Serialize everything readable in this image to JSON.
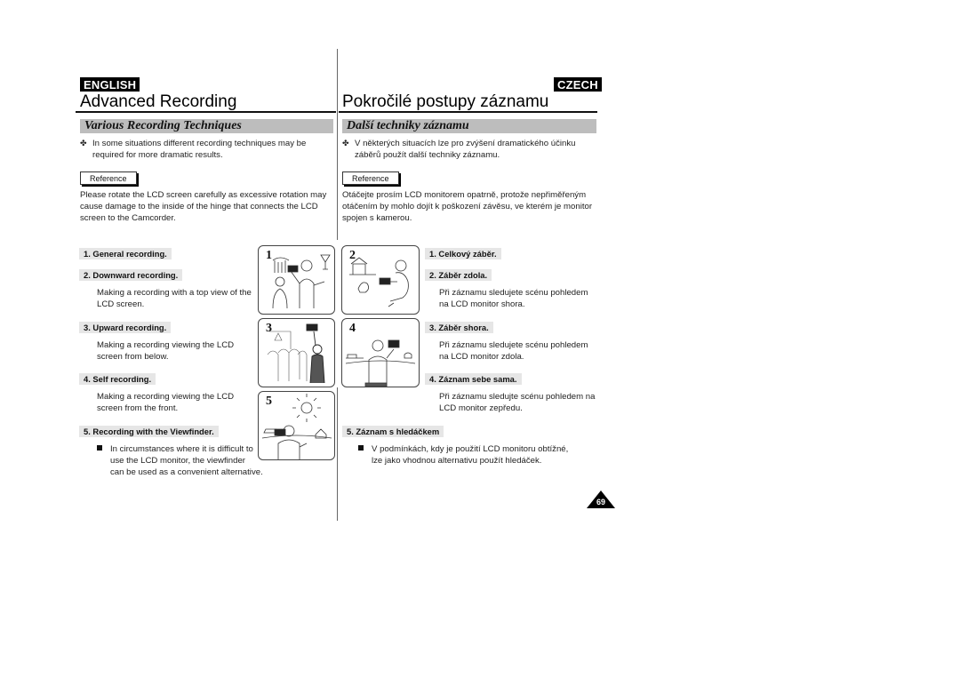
{
  "left": {
    "language_tag": "ENGLISH",
    "title": "Advanced Recording",
    "section_title": "Various Recording Techniques",
    "intro_bullet": "✤",
    "intro_lines": [
      "In some situations different recording techniques may be",
      "required for more dramatic results."
    ],
    "reference_label": "Reference",
    "reference_lines": [
      "Please rotate the LCD screen carefully as excessive rotation may",
      "cause damage to the inside of the hinge that connects the LCD",
      "screen to the Camcorder."
    ],
    "items": [
      {
        "head": "1.  General recording.",
        "body": []
      },
      {
        "head": "2.  Downward recording.",
        "body": [
          "Making a recording with a top view of the",
          "LCD screen."
        ]
      },
      {
        "head": "3.  Upward recording.",
        "body": [
          "Making a recording viewing the LCD",
          "screen from below."
        ]
      },
      {
        "head": "4.  Self recording.",
        "body": [
          "Making a recording viewing the LCD",
          "screen from the front."
        ]
      },
      {
        "head": "5.  Recording with the Viewfinder.",
        "body": [
          "In circumstances where it is difficult to",
          "use the LCD monitor, the viewfinder",
          "can be used as a convenient alternative."
        ]
      }
    ]
  },
  "right": {
    "language_tag": "CZECH",
    "title": "Pokročilé postupy záznamu",
    "section_title": "Další techniky záznamu",
    "intro_bullet": "✤",
    "intro_lines": [
      "V některých situacích lze pro zvýšení dramatického účinku",
      "záběrů použít další techniky záznamu."
    ],
    "reference_label": "Reference",
    "reference_lines": [
      "Otáčejte prosím LCD monitorem opatrně, protože nepřiměřeným",
      "otáčením by mohlo dojít k poškození závěsu, ve kterém je monitor",
      "spojen s kamerou."
    ],
    "items": [
      {
        "head": "1. Celkový záběr.",
        "body": []
      },
      {
        "head": "2. Záběr zdola.",
        "body": [
          "Při záznamu sledujete scénu pohledem",
          "na LCD monitor shora."
        ]
      },
      {
        "head": "3. Záběr shora.",
        "body": [
          "Při záznamu sledujete scénu pohledem",
          "na LCD monitor zdola."
        ]
      },
      {
        "head": "4. Záznam sebe sama.",
        "body": [
          "Při záznamu sledujte scénu pohledem na",
          "LCD monitor zepředu."
        ]
      },
      {
        "head": "5. Záznam s hledáčkem",
        "body": [
          "V podmínkách, kdy je použití LCD monitoru obtížné,",
          "lze jako vhodnou alternativu použít hledáček."
        ]
      }
    ]
  },
  "panels": [
    {
      "number": "1",
      "scene": "camcorder held at chest height filming a person, wine glasses in background"
    },
    {
      "number": "2",
      "scene": "crouching person filming a dog near a doghouse"
    },
    {
      "number": "3",
      "scene": "camcorder raised overhead above a crowd"
    },
    {
      "number": "4",
      "scene": "person filming landscape with camcorder at face level"
    },
    {
      "number": "5",
      "scene": "person using the viewfinder, sun in the sky"
    }
  ],
  "page_number": "69"
}
